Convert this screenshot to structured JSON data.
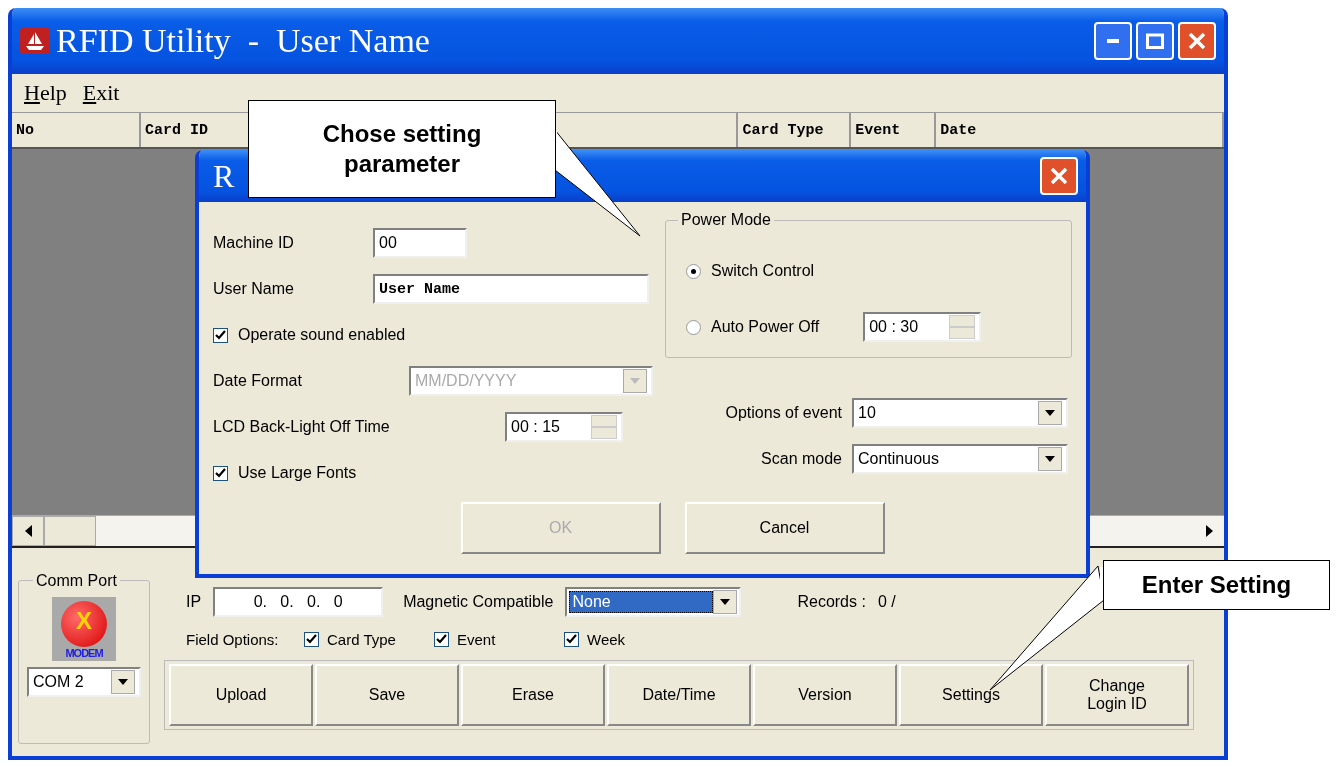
{
  "window": {
    "title": "RFID Utility  -  User Name"
  },
  "menu": [
    {
      "label": "Help"
    },
    {
      "label": "Exit"
    }
  ],
  "table": {
    "columns": [
      "No",
      "Card ID",
      "Card Type",
      "Event",
      "Date"
    ]
  },
  "dialog": {
    "title": "R",
    "machine_id": {
      "label": "Machine ID",
      "value": "00"
    },
    "user_name": {
      "label": "User Name",
      "value": "User Name"
    },
    "operate_sound": {
      "label": "Operate sound enabled",
      "checked": true
    },
    "date_format": {
      "label": "Date Format",
      "value": "MM/DD/YYYY",
      "disabled": true
    },
    "backlight": {
      "label": "LCD Back-Light Off Time",
      "value": "00 : 15"
    },
    "large_fonts": {
      "label": "Use Large Fonts",
      "checked": true
    },
    "power_mode": {
      "title": "Power Mode",
      "options": [
        {
          "label": "Switch Control",
          "selected": true
        },
        {
          "label": "Auto Power Off",
          "selected": false
        }
      ],
      "auto_off_time": "00 : 30"
    },
    "options_of_event": {
      "label": "Options of event",
      "value": "10"
    },
    "scan_mode": {
      "label": "Scan mode",
      "value": "Continuous"
    },
    "buttons": [
      {
        "label": "OK",
        "disabled": true
      },
      {
        "label": "Cancel",
        "disabled": false
      }
    ]
  },
  "bottom": {
    "comm_port": {
      "title": "Comm Port",
      "icon_mark": "X",
      "icon_caption": "MODEM",
      "value": "COM 2"
    },
    "ip": {
      "label": "IP",
      "value": "0.   0.   0.   0"
    },
    "magnetic": {
      "label": "Magnetic Compatible",
      "value": "None",
      "focused": true
    },
    "records": {
      "label": "Records :",
      "value": "0 /"
    },
    "field_options": {
      "label": "Field Options:",
      "items": [
        {
          "label": "Card Type",
          "checked": true
        },
        {
          "label": "Event",
          "checked": true
        },
        {
          "label": "Week",
          "checked": true
        }
      ]
    },
    "buttons": [
      "Upload",
      "Save",
      "Erase",
      "Date/Time",
      "Version",
      "Settings",
      "Change Login ID"
    ]
  },
  "callouts": [
    {
      "text": "Chose setting parameter"
    },
    {
      "text": "Enter Setting"
    }
  ]
}
